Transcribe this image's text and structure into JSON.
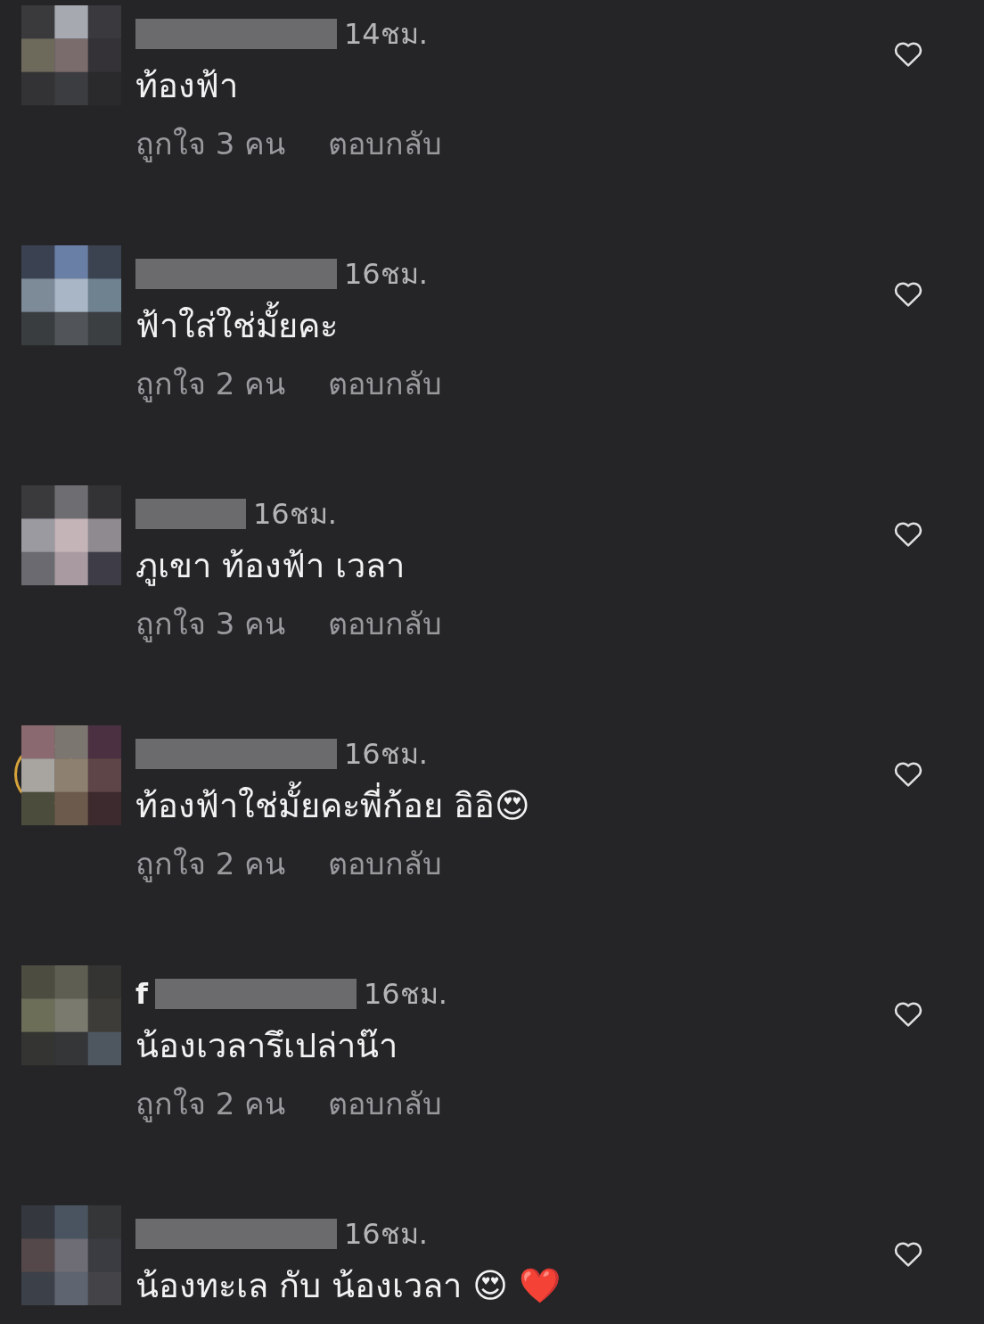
{
  "comments": [
    {
      "time": "14ชม.",
      "text": "ท้องฟ้า",
      "likes": "ถูกใจ 3 คน",
      "reply": "ตอบกลับ",
      "liked": false,
      "story_ring": false
    },
    {
      "time": "16ชม.",
      "text": "ฟ้าใส่ใช่มั้ยคะ",
      "likes": "ถูกใจ 2 คน",
      "reply": "ตอบกลับ",
      "liked": false,
      "story_ring": false
    },
    {
      "time": "16ชม.",
      "text": "ภูเขา ท้องฟ้า เวลา",
      "likes": "ถูกใจ 3 คน",
      "reply": "ตอบกลับ",
      "liked": false,
      "story_ring": false
    },
    {
      "time": "16ชม.",
      "text": "ท้องฟ้าใช่มั้ยคะพี่ก้อย อิอิ😍",
      "likes": "ถูกใจ 2 คน",
      "reply": "ตอบกลับ",
      "liked": false,
      "story_ring": true
    },
    {
      "username_visible": "f",
      "time": "16ชม.",
      "text": "น้องเวลารึเปล่าน๊า",
      "likes": "ถูกใจ 2 คน",
      "reply": "ตอบกลับ",
      "liked": false,
      "story_ring": false
    },
    {
      "time": "16ชม.",
      "text": "น้องทะเล กับ น้องเวลา 😍 ❤️",
      "liked": false,
      "story_ring": false
    }
  ]
}
